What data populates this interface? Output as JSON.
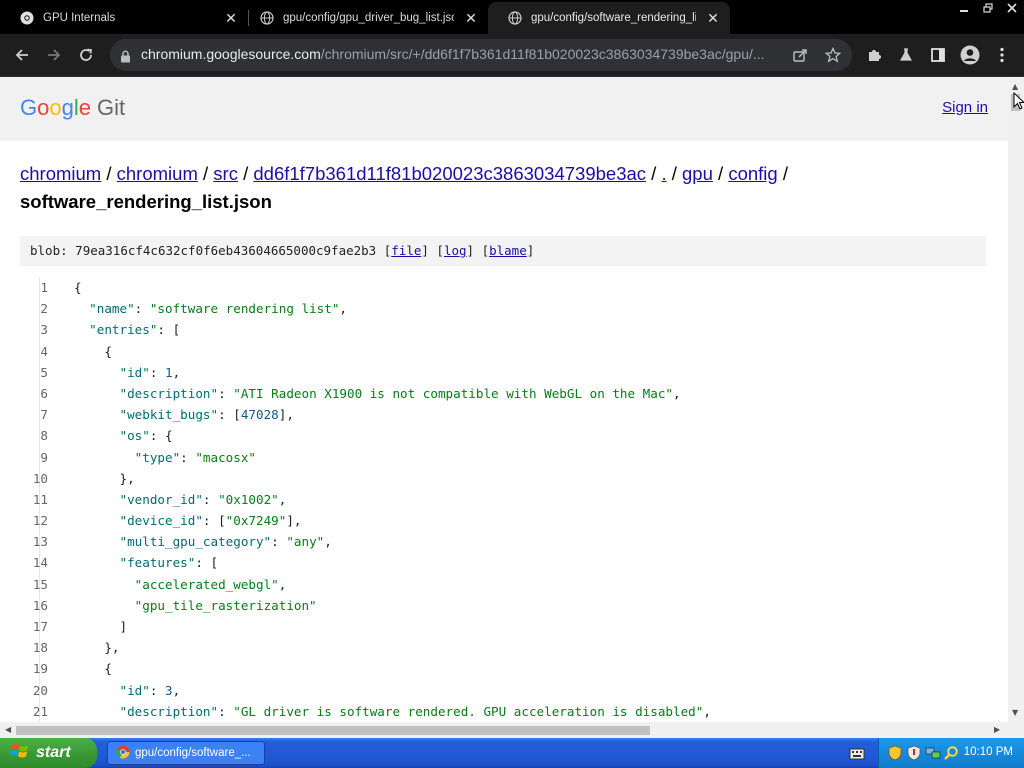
{
  "browser": {
    "tabs": [
      {
        "title": "GPU Internals",
        "active": false
      },
      {
        "title": "gpu/config/gpu_driver_bug_list.json",
        "active": false
      },
      {
        "title": "gpu/config/software_rendering_list",
        "active": true
      }
    ],
    "url_host": "chromium.googlesource.com",
    "url_path": "/chromium/src/+/dd6f1f7b361d11f81b020023c3863034739be3ac/gpu/..."
  },
  "header": {
    "logo_google": "Google",
    "logo_git": "Git",
    "sign_in": "Sign in"
  },
  "breadcrumb": {
    "items": [
      "chromium",
      "chromium",
      "src",
      "dd6f1f7b361d11f81b020023c3863034739be3ac",
      ".",
      "gpu",
      "config"
    ],
    "separator": "/",
    "current": "software_rendering_list.json"
  },
  "blob": {
    "label": "blob:",
    "hash": "79ea316cf4c632cf0f6eb43604665000c9fae2b3",
    "file_link": "file",
    "log_link": "log",
    "blame_link": "blame"
  },
  "code_lines": [
    {
      "n": "1",
      "text": "{"
    },
    {
      "n": "2",
      "text": "  \"name\": \"software rendering list\","
    },
    {
      "n": "3",
      "text": "  \"entries\": ["
    },
    {
      "n": "4",
      "text": "    {"
    },
    {
      "n": "5",
      "text": "      \"id\": 1,"
    },
    {
      "n": "6",
      "text": "      \"description\": \"ATI Radeon X1900 is not compatible with WebGL on the Mac\","
    },
    {
      "n": "7",
      "text": "      \"webkit_bugs\": [47028],"
    },
    {
      "n": "8",
      "text": "      \"os\": {"
    },
    {
      "n": "9",
      "text": "        \"type\": \"macosx\""
    },
    {
      "n": "10",
      "text": "      },"
    },
    {
      "n": "11",
      "text": "      \"vendor_id\": \"0x1002\","
    },
    {
      "n": "12",
      "text": "      \"device_id\": [\"0x7249\"],"
    },
    {
      "n": "13",
      "text": "      \"multi_gpu_category\": \"any\","
    },
    {
      "n": "14",
      "text": "      \"features\": ["
    },
    {
      "n": "15",
      "text": "        \"accelerated_webgl\","
    },
    {
      "n": "16",
      "text": "        \"gpu_tile_rasterization\""
    },
    {
      "n": "17",
      "text": "      ]"
    },
    {
      "n": "18",
      "text": "    },"
    },
    {
      "n": "19",
      "text": "    {"
    },
    {
      "n": "20",
      "text": "      \"id\": 3,"
    },
    {
      "n": "21",
      "text": "      \"description\": \"GL driver is software rendered. GPU acceleration is disabled\","
    }
  ],
  "taskbar": {
    "start_label": "start",
    "task_label": "gpu/config/software_...",
    "clock": "10:10 PM"
  },
  "colors": {
    "link": "#1a0dab",
    "json_key": "#006d74",
    "json_string": "#067d17",
    "json_number": "#0b5b8a"
  }
}
